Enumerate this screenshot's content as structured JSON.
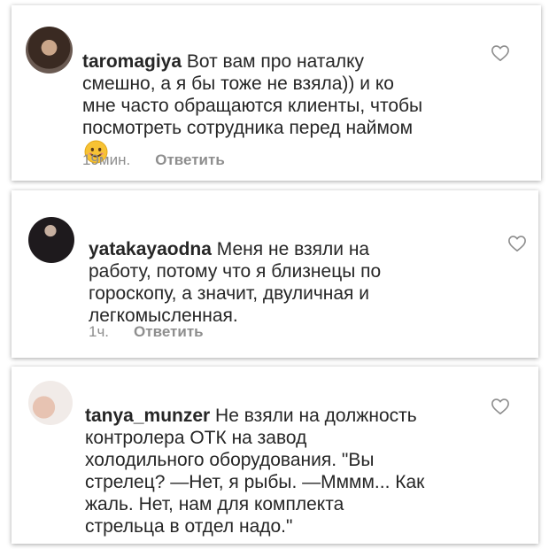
{
  "comments": [
    {
      "username": "taromagiya",
      "text": " Вот вам про наталку\nсмешно, а я бы тоже не взяла)) и ко\nмне часто обращаются клиенты, чтобы\nпосмотреть сотрудника перед наймом",
      "has_emoji": true,
      "emoji_icon": "smiling-face-emoji-icon",
      "time": "19мин.",
      "reply_label": "Ответить"
    },
    {
      "username": "yatakayaodna",
      "text": " Меня не взяли на\nработу, потому что я близнецы по\nгороскопу, а значит, двуличная и\nлегкомысленная.",
      "time": "1ч.",
      "reply_label": "Ответить"
    },
    {
      "username": "tanya_munzer",
      "text": " Не взяли на должность\nконтролера ОТК на завод\nхолодильного оборудования. \"Вы\nстрелец? —Нет, я рыбы. —Мммм... Как\nжаль. Нет, нам для комплекта\nстрельца в отдел надо.\""
    }
  ],
  "icons": {
    "like": "heart-outline-icon",
    "avatar": "user-avatar"
  },
  "colors": {
    "text": "#262626",
    "meta": "#8e8e8e",
    "heart": "#8e8e8e",
    "emoji": "#f7c234"
  }
}
